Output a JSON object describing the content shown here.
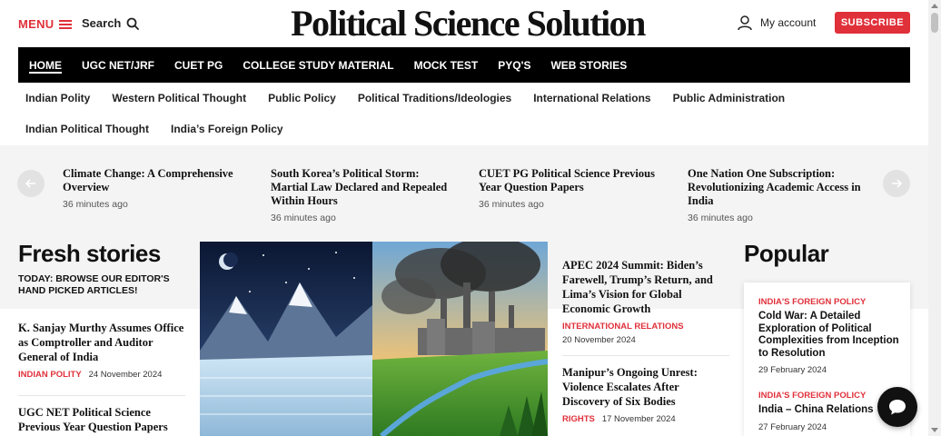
{
  "header": {
    "menu_label": "MENU",
    "search_label": "Search",
    "logo": "Political Science Solution",
    "account_label": "My account",
    "subscribe_label": "SUBSCRIBE"
  },
  "main_nav": [
    "HOME",
    "UGC NET/JRF",
    "CUET PG",
    "COLLEGE STUDY MATERIAL",
    "MOCK TEST",
    "PYQ'S",
    "WEB STORIES"
  ],
  "sub_nav_row1": [
    "Indian Polity",
    "Western Political Thought",
    "Public Policy",
    "Political Traditions/Ideologies",
    "International Relations",
    "Public Administration"
  ],
  "sub_nav_row2": [
    "Indian Political Thought",
    "India’s Foreign Policy"
  ],
  "ticker": [
    {
      "title": "Climate Change: A Comprehensive Overview",
      "time": "36 minutes ago"
    },
    {
      "title": "South Korea’s Political Storm: Martial Law Declared and Repealed Within Hours",
      "time": "36 minutes ago"
    },
    {
      "title": "CUET PG Political Science Previous Year Question Papers",
      "time": "36 minutes ago"
    },
    {
      "title": "One Nation One Subscription: Revolutionizing Academic Access in India",
      "time": "36 minutes ago"
    }
  ],
  "fresh": {
    "title": "Fresh stories",
    "subtitle": "TODAY: BROWSE OUR EDITOR'S HAND PICKED ARTICLES!",
    "stories": [
      {
        "title": "K. Sanjay Murthy Assumes Office as Comptroller and Auditor General of India",
        "category": "INDIAN POLITY",
        "date": "24 November 2024"
      },
      {
        "title": "UGC NET Political Science Previous Year Question Papers",
        "category": "",
        "date": ""
      }
    ]
  },
  "middle": [
    {
      "title": "APEC 2024 Summit: Biden’s Farewell, Trump’s Return, and Lima’s Vision for Global Economic Growth",
      "category": "INTERNATIONAL RELATIONS",
      "date": "20 November 2024"
    },
    {
      "title": "Manipur’s Ongoing Unrest: Violence Escalates After Discovery of Six Bodies",
      "category": "RIGHTS",
      "date": "17 November 2024"
    }
  ],
  "popular": {
    "title": "Popular",
    "items": [
      {
        "category": "INDIA'S FOREIGN POLICY",
        "title": "Cold War: A Detailed Exploration of Political Complexities from Inception to Resolution",
        "date": "29 February 2024"
      },
      {
        "category": "INDIA'S FOREIGN POLICY",
        "title": "India – China Relations",
        "date": "27 February 2024"
      }
    ]
  },
  "colors": {
    "accent": "#e0303a",
    "nav_bg": "#000000",
    "band_bg": "#f4f4f4"
  },
  "icons": [
    "hamburger-icon",
    "search-icon",
    "user-icon",
    "arrow-left-icon",
    "arrow-right-icon",
    "chat-icon"
  ]
}
